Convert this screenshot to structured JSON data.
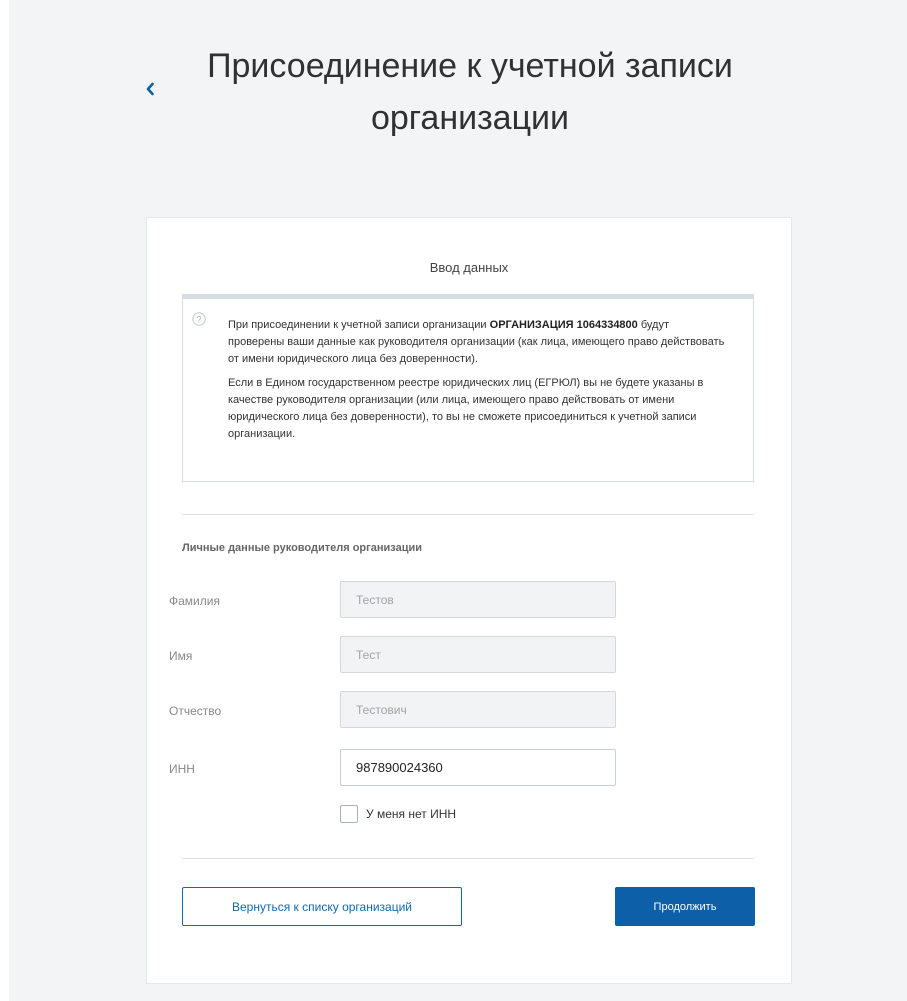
{
  "header": {
    "title": "Присоединение к учетной записи организации"
  },
  "card": {
    "heading": "Ввод данных",
    "info": {
      "p1_before": "При присоединении к учетной записи организации ",
      "p1_org": "ОРГАНИЗАЦИЯ 1064334800",
      "p1_after": " будут проверены ваши данные как руководителя организации (как лица, имеющего право действовать от имени юридического лица без доверенности).",
      "p2": "Если в Едином государственном реестре юридических лиц (ЕГРЮЛ) вы не будете указаны в качестве руководителя организации (или лица, имеющего право действовать от имени юридического лица без доверенности), то вы не сможете присоединиться к учетной записи организации."
    },
    "section_title": "Личные данные руководителя организации",
    "fields": {
      "surname": {
        "label": "Фамилия",
        "value": "Тестов"
      },
      "name": {
        "label": "Имя",
        "value": "Тест"
      },
      "patronymic": {
        "label": "Отчество",
        "value": "Тестович"
      },
      "inn": {
        "label": "ИНН",
        "value": "987890024360"
      }
    },
    "no_inn_label": "У меня нет ИНН",
    "no_inn_checked": false,
    "back_button": "Вернуться к списку организаций",
    "continue_button": "Продолжить"
  },
  "colors": {
    "accent": "#0d5fa8",
    "background": "#f3f4f6"
  },
  "icons": {
    "back": "chevron-left-icon",
    "info": "question-circle-icon"
  }
}
